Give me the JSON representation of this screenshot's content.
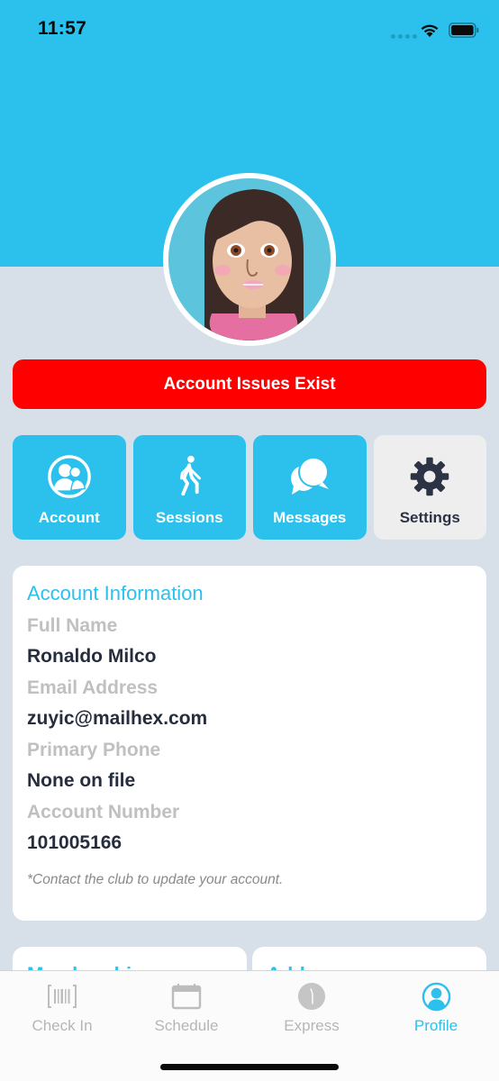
{
  "status_bar": {
    "time": "11:57"
  },
  "colors": {
    "brand": "#2bc1ec",
    "alert": "#fe0000",
    "background": "#d7e0e9",
    "text_dark": "#262d3d",
    "label_grey": "#c0c0c0"
  },
  "profile": {
    "avatar": "cartoon-avatar-woman"
  },
  "alert": {
    "label": "Account Issues Exist"
  },
  "tiles": [
    {
      "label": "Account",
      "icon": "users-circle-icon"
    },
    {
      "label": "Sessions",
      "icon": "walking-person-icon"
    },
    {
      "label": "Messages",
      "icon": "chat-bubbles-icon"
    },
    {
      "label": "Settings",
      "icon": "gear-icon"
    }
  ],
  "account_info": {
    "title": "Account Information",
    "fields": [
      {
        "label": "Full Name",
        "value": "Ronaldo Milco"
      },
      {
        "label": "Email Address",
        "value": "zuyic@mailhex.com"
      },
      {
        "label": "Primary Phone",
        "value": "None on file"
      },
      {
        "label": "Account Number",
        "value": "101005166"
      }
    ],
    "note": "*Contact the club to update your account."
  },
  "lower_cards": [
    {
      "title": "Memberships"
    },
    {
      "title": "Add-ons"
    }
  ],
  "tab_bar": {
    "items": [
      {
        "label": "Check In",
        "icon": "barcode-icon",
        "active": false
      },
      {
        "label": "Schedule",
        "icon": "calendar-icon",
        "active": false
      },
      {
        "label": "Express",
        "icon": "clock-icon",
        "active": false
      },
      {
        "label": "Profile",
        "icon": "profile-icon",
        "active": true
      }
    ]
  }
}
